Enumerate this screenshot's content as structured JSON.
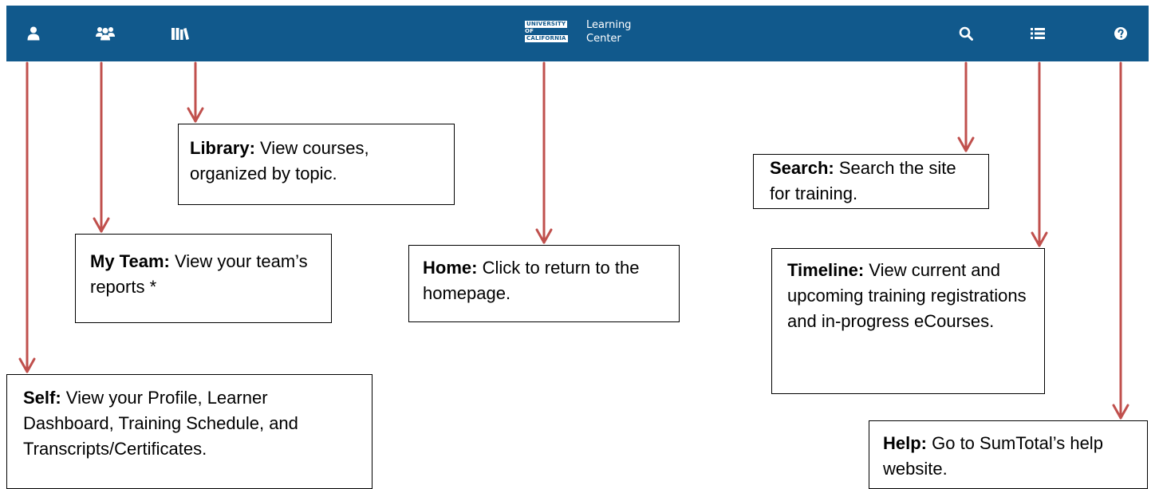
{
  "navbar": {
    "background": "#11598c",
    "icons": [
      "user-icon",
      "users-icon",
      "library-icon",
      "search-icon",
      "list-icon",
      "help-icon"
    ],
    "logo": {
      "line1": "UNIVERSITY",
      "line2": "OF",
      "line3": "CALIFORNIA",
      "title_line1": "Learning",
      "title_line2": "Center"
    }
  },
  "arrow_color": "#c0504d",
  "callouts": {
    "library": {
      "title": "Library:",
      "text": " View courses, organized by topic."
    },
    "search": {
      "title": "Search:",
      "text": " Search the site for training."
    },
    "myteam": {
      "title": "My Team:",
      "text": " View your team’s reports *"
    },
    "home": {
      "title": "Home:",
      "text": " Click to return to the homepage."
    },
    "timeline": {
      "title": "Timeline:",
      "text": " View current and upcoming training registrations and in-progress eCourses."
    },
    "self": {
      "title": "Self:",
      "text": " View your Profile, Learner Dashboard, Training Schedule, and Transcripts/Certificates."
    },
    "help": {
      "title": "Help:",
      "text": " Go to SumTotal’s help website."
    }
  }
}
